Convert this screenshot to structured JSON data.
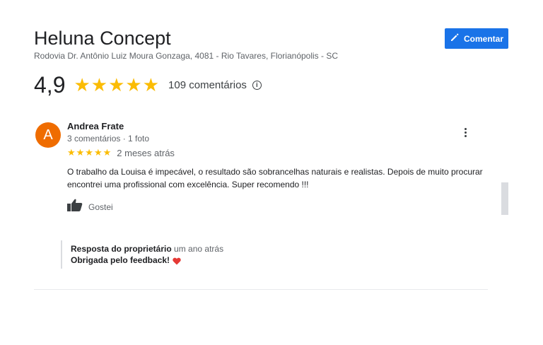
{
  "place": {
    "name": "Heluna Concept",
    "address": "Rodovia Dr. Antônio Luiz Moura Gonzaga, 4081 - Rio Tavares, Florianópolis - SC"
  },
  "actions": {
    "comment_label": "Comentar"
  },
  "summary": {
    "rating": "4,9",
    "stars_display": "★★★★★",
    "stars_value": 5,
    "reviews_count": "109 comentários"
  },
  "review": {
    "avatar_letter": "A",
    "avatar_color": "#ef6c00",
    "author": "Andrea Frate",
    "meta": "3 comentários · 1 foto",
    "stars_display": "★★★★★",
    "stars_value": 5,
    "time": "2 meses atrás",
    "text": "O trabalho da Louisa é impecável,  o resultado são sobrancelhas naturais e realistas.  Depois de muito procurar encontrei uma profissional com excelência.  Super recomendo  !!!",
    "like_label": "Gostei"
  },
  "reply": {
    "heading": "Resposta do proprietário",
    "time": "um ano atrás",
    "text": "Obrigada pelo feedback!"
  },
  "colors": {
    "accent": "#1a73e8",
    "star": "#fbbc04",
    "heart": "#e53935"
  },
  "icons": {
    "comment": "pencil-icon",
    "info": "info-icon",
    "more": "more-vertical-icon",
    "like": "thumbs-up-icon",
    "heart": "heart-icon"
  }
}
